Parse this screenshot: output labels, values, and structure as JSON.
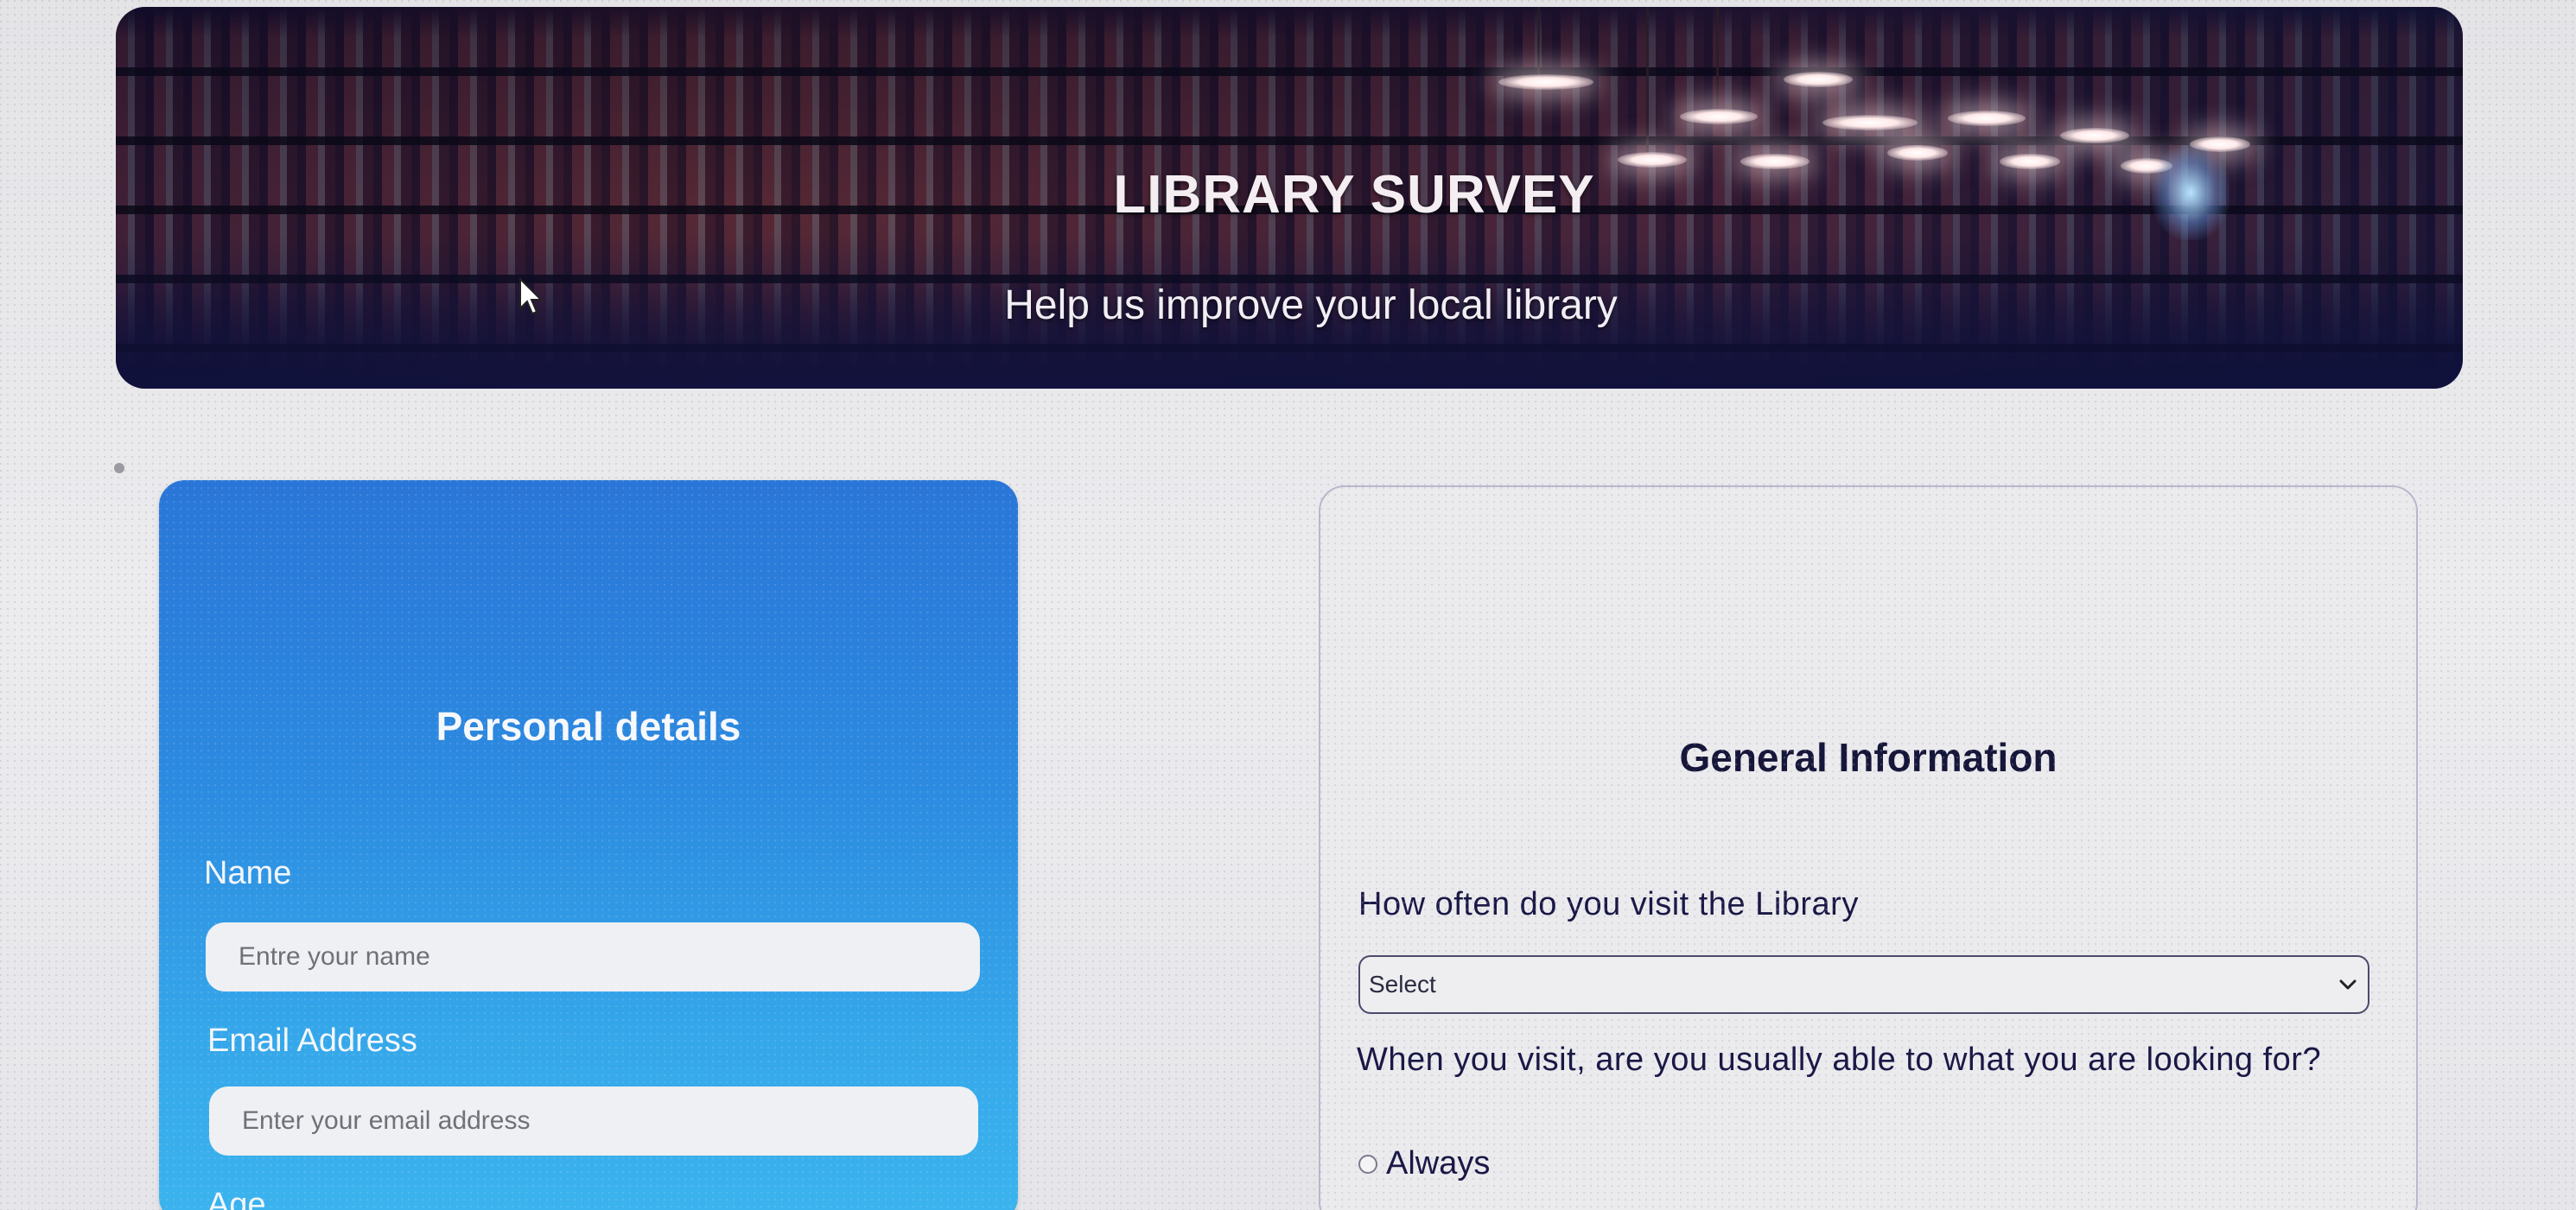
{
  "header": {
    "title": "LIBRARY SURVEY",
    "subtitle": "Help us improve your local library"
  },
  "personal_details": {
    "heading": "Personal details",
    "name_label": "Name",
    "name_placeholder": "Entre your name",
    "email_label": "Email Address",
    "email_placeholder": "Enter your email address",
    "age_label": "Age"
  },
  "general_information": {
    "heading": "General Information",
    "q1": "How often do you visit the Library",
    "q1_select_value": "Select",
    "q2": "When you visit, are you usually able to what you are looking for?",
    "q2_options": [
      "Always"
    ]
  },
  "colors": {
    "personal_card_top": "#2a76d8",
    "personal_card_bottom": "#3bb4ee",
    "general_text": "#1a1846",
    "banner_overlay": "#1a1c48"
  },
  "icons": {
    "select_arrow": "chevron-down-icon",
    "cursor": "mouse-pointer-icon"
  }
}
